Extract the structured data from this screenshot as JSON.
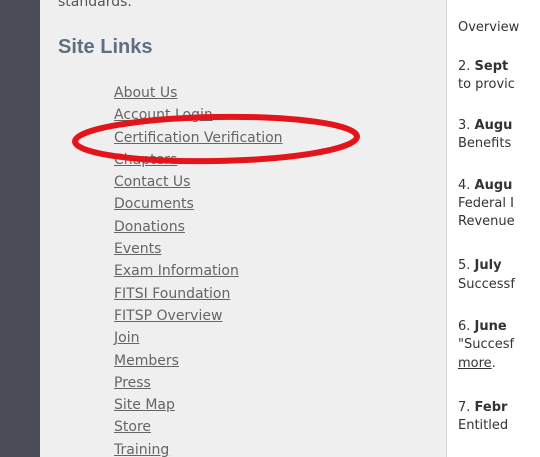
{
  "sidebar": {
    "standards_text": "standards.",
    "title": "Site Links",
    "links": [
      "About Us",
      "Account Login",
      "Certification Verification",
      "Chapters",
      "Contact Us",
      "Documents",
      "Donations",
      "Events",
      "Exam Information",
      "FITSI Foundation",
      "FITSP Overview",
      "Join",
      "Members",
      "Press",
      "Site Map",
      "Store",
      "Training"
    ]
  },
  "news": {
    "item1_line1": "Overview",
    "item2_num": "2.",
    "item2_month": "Sept",
    "item2_line2": "to provic",
    "item3_num": "3.",
    "item3_month": "Augu",
    "item3_line2": "Benefits",
    "item4_num": "4.",
    "item4_month": "Augu",
    "item4_line2": "Federal I",
    "item4_line3": "Revenue",
    "item5_num": "5.",
    "item5_month": "July",
    "item5_line2": "Successf",
    "item6_num": "6.",
    "item6_month": "June",
    "item6_line2": "\"Succesf",
    "item6_more": "more",
    "item6_period": ".",
    "item7_num": "7.",
    "item7_month": "Febr",
    "item7_line2": "Entitled"
  },
  "annotation": {
    "color": "#e4141b"
  }
}
